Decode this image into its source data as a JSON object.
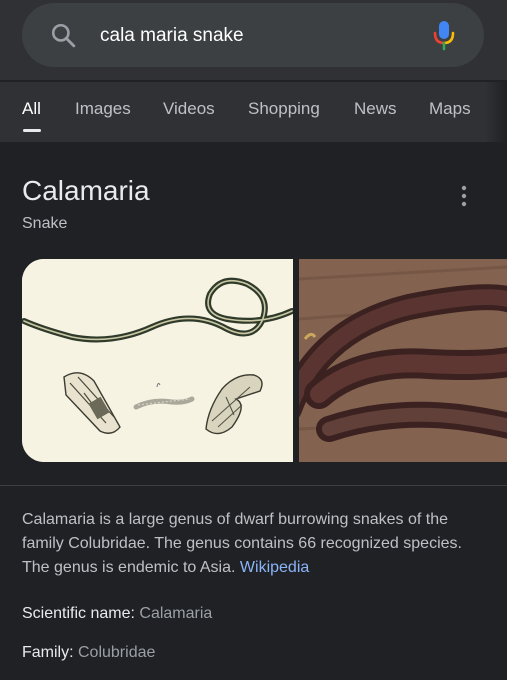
{
  "search": {
    "query": "cala maria snake"
  },
  "tabs": [
    {
      "label": "All",
      "active": true
    },
    {
      "label": "Images"
    },
    {
      "label": "Videos"
    },
    {
      "label": "Shopping"
    },
    {
      "label": "News"
    },
    {
      "label": "Maps"
    }
  ],
  "knowledge_panel": {
    "title": "Calamaria",
    "subtitle": "Snake",
    "description": "Calamaria is a large genus of dwarf burrowing snakes of the family Colubridae. The genus contains 66 recognized species. The genus is endemic to Asia.",
    "source_link": "Wikipedia",
    "facts": [
      {
        "key": "Scientific name",
        "value": "Calamaria"
      },
      {
        "key": "Family",
        "value": "Colubridae"
      }
    ]
  },
  "icons": {
    "search": "search-icon",
    "mic": "mic-icon",
    "more": "more-vert-icon"
  },
  "colors": {
    "background": "#202124",
    "link": "#8ab4f8",
    "mic_blue": "#4285f4",
    "mic_red": "#ea4335",
    "mic_yellow": "#fbbc04",
    "mic_green": "#34a853"
  }
}
